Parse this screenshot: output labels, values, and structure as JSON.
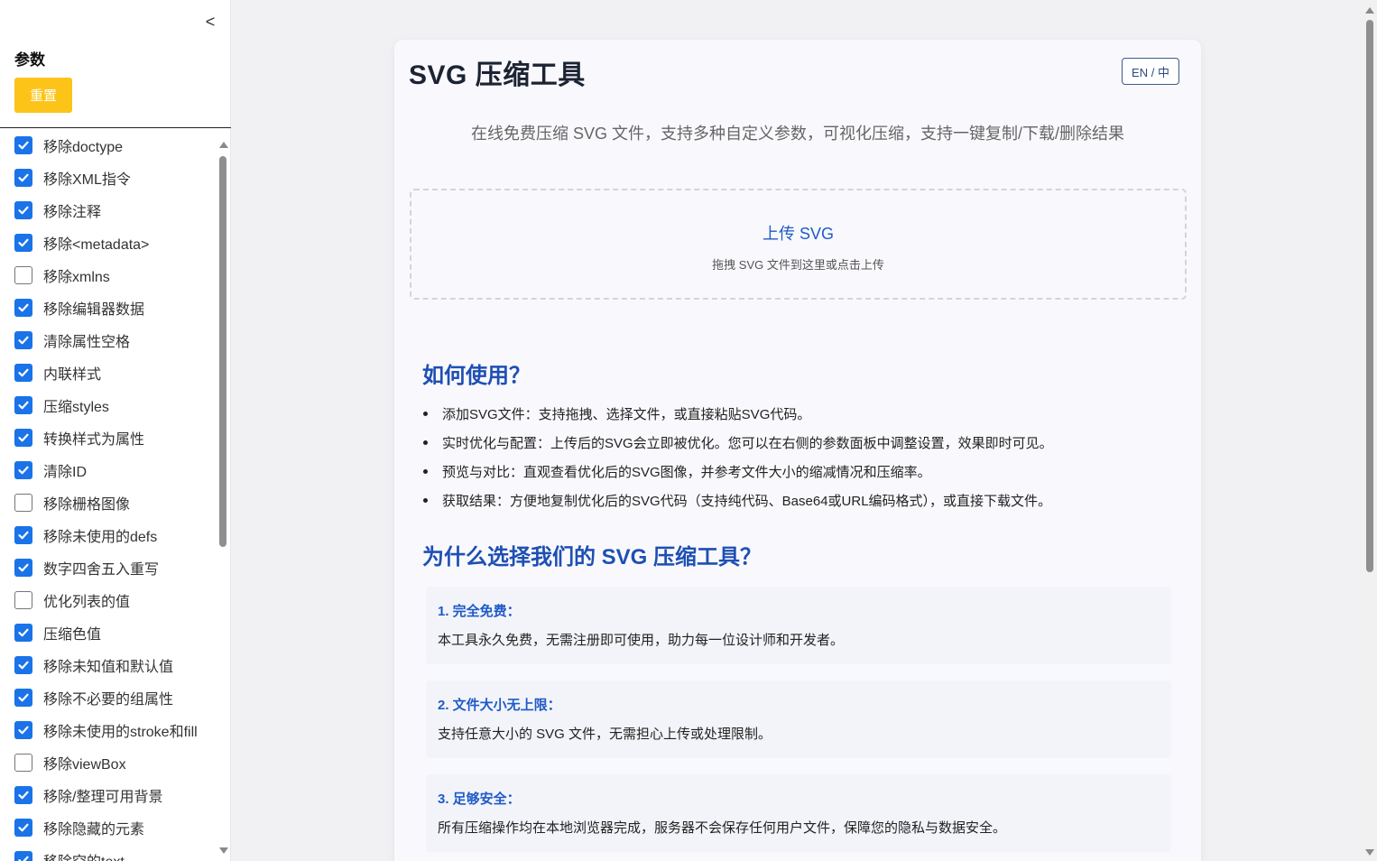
{
  "sidebar": {
    "collapse_label": "<",
    "title": "参数",
    "reset_label": "重置",
    "options": [
      {
        "label": "移除doctype",
        "checked": true
      },
      {
        "label": "移除XML指令",
        "checked": true
      },
      {
        "label": "移除注释",
        "checked": true
      },
      {
        "label": "移除<metadata>",
        "checked": true
      },
      {
        "label": "移除xmlns",
        "checked": false
      },
      {
        "label": "移除编辑器数据",
        "checked": true
      },
      {
        "label": "清除属性空格",
        "checked": true
      },
      {
        "label": "内联样式",
        "checked": true
      },
      {
        "label": "压缩styles",
        "checked": true
      },
      {
        "label": "转换样式为属性",
        "checked": true
      },
      {
        "label": "清除ID",
        "checked": true
      },
      {
        "label": "移除栅格图像",
        "checked": false
      },
      {
        "label": "移除未使用的defs",
        "checked": true
      },
      {
        "label": "数字四舍五入重写",
        "checked": true
      },
      {
        "label": "优化列表的值",
        "checked": false
      },
      {
        "label": "压缩色值",
        "checked": true
      },
      {
        "label": "移除未知值和默认值",
        "checked": true
      },
      {
        "label": "移除不必要的组属性",
        "checked": true
      },
      {
        "label": "移除未使用的stroke和fill",
        "checked": true
      },
      {
        "label": "移除viewBox",
        "checked": false
      },
      {
        "label": "移除/整理可用背景",
        "checked": true
      },
      {
        "label": "移除隐藏的元素",
        "checked": true
      },
      {
        "label": "移除空的text",
        "checked": true
      }
    ]
  },
  "main": {
    "title": "SVG 压缩工具",
    "lang_toggle": "EN / 中",
    "subtitle": "在线免费压缩 SVG 文件，支持多种自定义参数，可视化压缩，支持一键复制/下载/删除结果",
    "upload": {
      "title": "上传 SVG",
      "hint": "拖拽 SVG 文件到这里或点击上传"
    },
    "how_to": {
      "heading": "如何使用？",
      "items": [
        "添加SVG文件：支持拖拽、选择文件，或直接粘贴SVG代码。",
        "实时优化与配置：上传后的SVG会立即被优化。您可以在右侧的参数面板中调整设置，效果即时可见。",
        "预览与对比：直观查看优化后的SVG图像，并参考文件大小的缩减情况和压缩率。",
        "获取结果：方便地复制优化后的SVG代码（支持纯代码、Base64或URL编码格式），或直接下载文件。"
      ]
    },
    "why": {
      "heading": "为什么选择我们的 SVG 压缩工具？",
      "features": [
        {
          "title": "1. 完全免费：",
          "desc": "本工具永久免费，无需注册即可使用，助力每一位设计师和开发者。"
        },
        {
          "title": "2. 文件大小无上限：",
          "desc": "支持任意大小的 SVG 文件，无需担心上传或处理限制。"
        },
        {
          "title": "3. 足够安全：",
          "desc": "所有压缩操作均在本地浏览器完成，服务器不会保存任何用户文件，保障您的隐私与数据安全。"
        }
      ]
    }
  },
  "colors": {
    "accent": "#1a73e8",
    "reset_button": "#fcc419",
    "heading": "#1e4fb3"
  }
}
